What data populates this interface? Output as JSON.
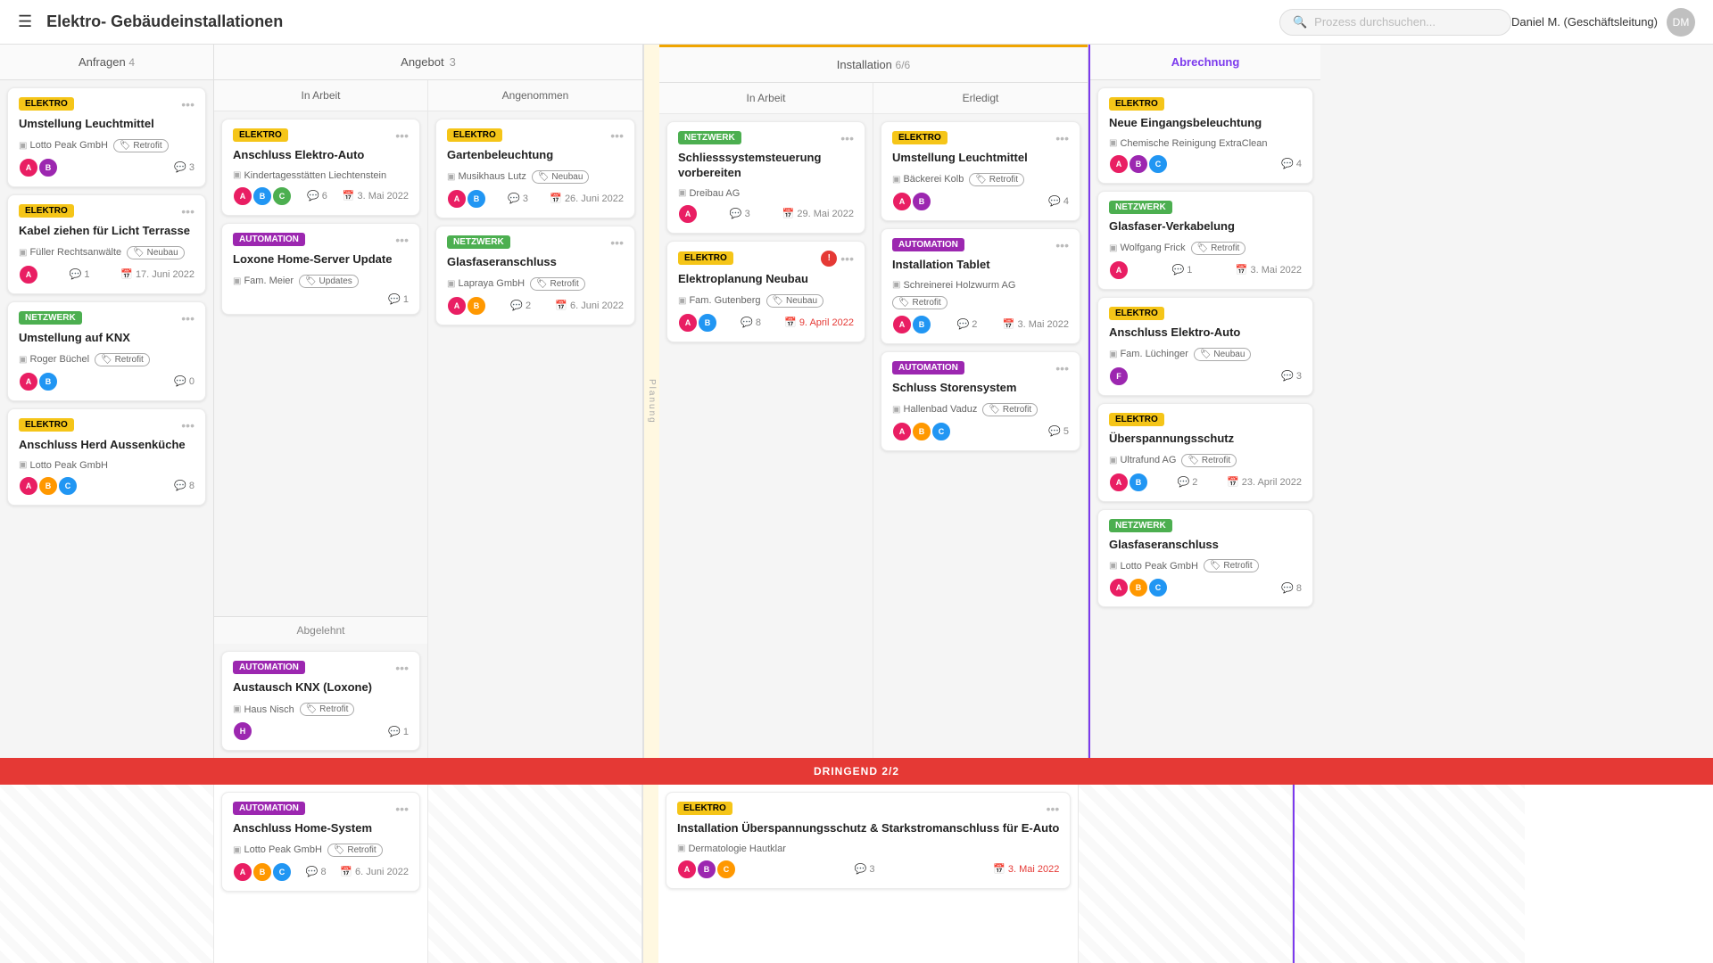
{
  "header": {
    "menu_icon": "☰",
    "title": "Elektro- Gebäudeinstallationen",
    "search_placeholder": "Prozess durchsuchen...",
    "user_name": "Daniel M. (Geschäftsleitung)"
  },
  "columns": {
    "anfragen": {
      "label": "Anfragen",
      "count": "4",
      "cards": [
        {
          "tag": "ELEKTRO",
          "tag_type": "elektro",
          "title": "Umstellung Leuchtmittel",
          "company": "Lotto Peak GmbH",
          "label": "Retrofit",
          "label_type": "retrofit",
          "avatars": [
            "#e91e63",
            "#9c27b0"
          ],
          "comments": "3",
          "date": ""
        },
        {
          "tag": "ELEKTRO",
          "tag_type": "elektro",
          "title": "Kabel ziehen für Licht Terrasse",
          "company": "Füller Rechtsanwälte",
          "label": "Neubau",
          "label_type": "neubau",
          "avatars": [
            "#e91e63"
          ],
          "comments": "1",
          "date": "17. Juni 2022"
        },
        {
          "tag": "NETZWERK",
          "tag_type": "netzwerk",
          "title": "Umstellung auf KNX",
          "company": "Roger Büchel",
          "label": "Retrofit",
          "label_type": "retrofit",
          "avatars": [
            "#e91e63",
            "#2196f3"
          ],
          "comments": "0",
          "date": ""
        },
        {
          "tag": "ELEKTRO",
          "tag_type": "elektro",
          "title": "Anschluss Herd Aussenküche",
          "company": "Lotto Peak GmbH",
          "label": "",
          "avatars": [
            "#e91e63",
            "#ff9800",
            "#2196f3"
          ],
          "comments": "8",
          "date": ""
        }
      ]
    },
    "angebot": {
      "label": "Angebot",
      "count": "3",
      "in_arbeit": {
        "label": "In Arbeit",
        "cards": [
          {
            "tag": "ELEKTRO",
            "tag_type": "elektro",
            "title": "Anschluss Elektro-Auto",
            "company": "Kindertagesstätten Liechtenstein",
            "label": "",
            "avatars": [
              "#e91e63",
              "#2196f3",
              "#4caf50"
            ],
            "comments": "6",
            "date": "3. Mai 2022"
          },
          {
            "tag": "AUTOMATION",
            "tag_type": "automation",
            "title": "Loxone Home-Server Update",
            "company": "Fam. Meier",
            "label": "Updates",
            "label_type": "updates",
            "avatars": [],
            "comments": "1",
            "date": ""
          }
        ]
      },
      "angenommen": {
        "label": "Angenommen",
        "cards": [
          {
            "tag": "ELEKTRO",
            "tag_type": "elektro",
            "title": "Gartenbeleuchtung",
            "company": "Musikhaus Lutz",
            "label": "Neubau",
            "label_type": "neubau",
            "avatars": [
              "#e91e63",
              "#2196f3"
            ],
            "comments": "3",
            "date": "26. Juni 2022"
          },
          {
            "tag": "NETZWERK",
            "tag_type": "netzwerk",
            "title": "Glasfaseranschluss",
            "company": "Lapraya GmbH",
            "label": "Retrofit",
            "label_type": "retrofit",
            "avatars": [
              "#e91e63",
              "#ff9800"
            ],
            "comments": "2",
            "date": "6. Juni 2022"
          }
        ]
      },
      "abgelehnt": {
        "label": "Abgelehnt",
        "cards": [
          {
            "tag": "AUTOMATION",
            "tag_type": "automation",
            "title": "Austausch KNX (Loxone)",
            "company": "Haus Nisch",
            "label": "Retrofit",
            "label_type": "retrofit",
            "avatars": [
              "#9c27b0"
            ],
            "comments": "1",
            "date": ""
          }
        ]
      }
    },
    "installation": {
      "label": "Installation",
      "count": "6/6",
      "in_arbeit": {
        "label": "In Arbeit",
        "cards": [
          {
            "tag": "NETZWERK",
            "tag_type": "netzwerk",
            "title": "Schliesssystemsteuerung vorbereiten",
            "company": "Dreibau AG",
            "label": "",
            "avatars": [
              "#e91e63"
            ],
            "comments": "3",
            "date": "29. Mai 2022",
            "date_overdue": false
          },
          {
            "tag": "ELEKTRO",
            "tag_type": "elektro",
            "title": "Elektroplanung Neubau",
            "company": "Fam. Gutenberg",
            "label": "Neubau",
            "label_type": "neubau",
            "warning": true,
            "avatars": [
              "#e91e63",
              "#2196f3"
            ],
            "comments": "8",
            "date": "9. April 2022",
            "date_overdue": true
          }
        ]
      },
      "erledigt": {
        "label": "Erledigt",
        "cards": [
          {
            "tag": "ELEKTRO",
            "tag_type": "elektro",
            "title": "Umstellung Leuchtmittel",
            "company": "Bäckerei Kolb",
            "label": "Retrofit",
            "label_type": "retrofit",
            "avatars": [
              "#e91e63",
              "#9c27b0"
            ],
            "comments": "4",
            "date": ""
          },
          {
            "tag": "AUTOMATION",
            "tag_type": "automation",
            "title": "Installation Tablet",
            "company": "Schreinerei Holzwurm AG",
            "label": "Retrofit",
            "label_type": "retrofit",
            "avatars": [
              "#e91e63",
              "#2196f3"
            ],
            "comments": "2",
            "date": "3. Mai 2022",
            "date_overdue": false
          },
          {
            "tag": "AUTOMATION",
            "tag_type": "automation",
            "title": "Schluss Storensystem",
            "company": "Hallenbad Vaduz",
            "label": "Retrofit",
            "label_type": "retrofit",
            "avatars": [
              "#e91e63",
              "#ff9800",
              "#2196f3"
            ],
            "comments": "5",
            "date": ""
          }
        ]
      }
    },
    "abrechnung": {
      "label": "Abrechnung",
      "cards": [
        {
          "tag": "ELEKTRO",
          "tag_type": "elektro",
          "title": "Neue Eingangsbeleuchtung",
          "company": "Chemische Reinigung ExtraClean",
          "label": "",
          "avatars": [
            "#e91e63",
            "#9c27b0",
            "#2196f3"
          ],
          "comments": "4",
          "date": ""
        },
        {
          "tag": "NETZWERK",
          "tag_type": "netzwerk",
          "title": "Glasfaser-Verkabelung",
          "company": "Wolfgang Frick",
          "label": "Retrofit",
          "label_type": "retrofit",
          "avatars": [
            "#e91e63"
          ],
          "comments": "1",
          "date": "3. Mai 2022",
          "date_overdue": false
        },
        {
          "tag": "ELEKTRO",
          "tag_type": "elektro",
          "title": "Anschluss Elektro-Auto",
          "company": "Fam. Lüchinger",
          "label": "Neubau",
          "label_type": "neubau",
          "avatars": [
            "#9c27b0"
          ],
          "comments": "3",
          "date": ""
        },
        {
          "tag": "ELEKTRO",
          "tag_type": "elektro",
          "title": "Überspannungsschutz",
          "company": "Ultrafund AG",
          "label": "Retrofit",
          "label_type": "retrofit",
          "avatars": [
            "#e91e63",
            "#2196f3"
          ],
          "comments": "2",
          "date": "23. April 2022",
          "date_overdue": false
        },
        {
          "tag": "NETZWERK",
          "tag_type": "netzwerk",
          "title": "Glasfaseranschluss",
          "company": "Lotto Peak GmbH",
          "label": "Retrofit",
          "label_type": "retrofit",
          "avatars": [
            "#e91e63",
            "#ff9800",
            "#2196f3"
          ],
          "comments": "8",
          "date": ""
        }
      ]
    }
  },
  "urgent": {
    "label": "DRINGEND 2/2",
    "cards": [
      {
        "tag": "AUTOMATION",
        "tag_type": "automation",
        "title": "Anschluss Home-System",
        "company": "Lotto Peak GmbH",
        "label": "Retrofit",
        "label_type": "retrofit",
        "avatars": [
          "#e91e63",
          "#ff9800",
          "#2196f3"
        ],
        "comments": "8",
        "date": "6. Juni 2022",
        "date_overdue": false
      },
      {
        "tag": "ELEKTRO",
        "tag_type": "elektro",
        "title": "Installation Überspannungsschutz & Starkstromanschluss für E-Auto",
        "company": "Dermatologie Hautklar",
        "label": "",
        "avatars": [
          "#e91e63",
          "#9c27b0",
          "#ff9800"
        ],
        "comments": "3",
        "date": "3. Mai 2022",
        "date_overdue": true
      }
    ]
  },
  "planung": {
    "label": "Planung"
  }
}
